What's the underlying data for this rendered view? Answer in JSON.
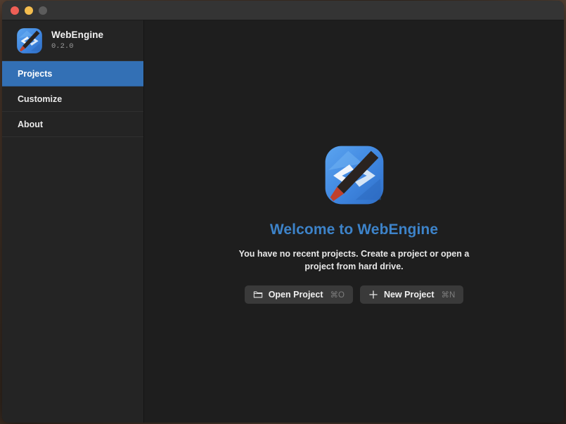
{
  "window": {
    "titlebar": {
      "close_label": "close",
      "minimize_label": "minimize",
      "zoom_label": "zoom"
    }
  },
  "sidebar": {
    "brand": {
      "logo_icon": "webengine-logo-icon",
      "name": "WebEngine",
      "version": "0.2.0"
    },
    "items": [
      {
        "label": "Projects",
        "active": true
      },
      {
        "label": "Customize",
        "active": false
      },
      {
        "label": "About",
        "active": false
      }
    ]
  },
  "main": {
    "welcome": {
      "logo_icon": "webengine-logo-icon",
      "title": "Welcome to WebEngine",
      "description": "You have no recent projects. Create a project or open a project from hard drive.",
      "actions": [
        {
          "icon": "folder-icon",
          "label": "Open Project",
          "shortcut": "⌘O"
        },
        {
          "icon": "plus-icon",
          "label": "New Project",
          "shortcut": "⌘N"
        }
      ]
    }
  },
  "colors": {
    "accent_blue": "#3370b5",
    "title_blue": "#3d83c9",
    "sidebar_bg": "#242424",
    "main_bg": "#1e1e1e",
    "titlebar_bg": "#343434",
    "button_bg": "#3a3a3a",
    "traffic_close": "#ee5f56",
    "traffic_minimize": "#f4bd4e",
    "traffic_zoom": "#5c5c5c"
  }
}
